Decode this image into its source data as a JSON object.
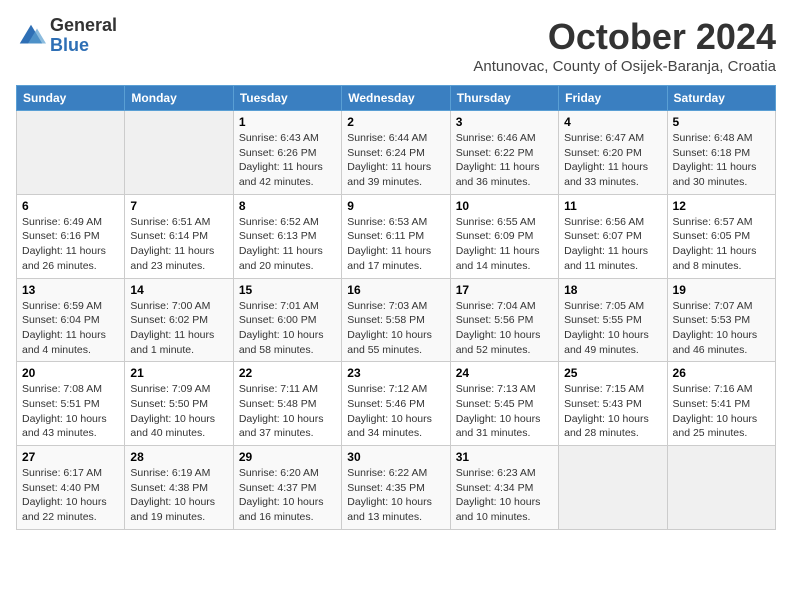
{
  "header": {
    "logo_general": "General",
    "logo_blue": "Blue",
    "month_title": "October 2024",
    "subtitle": "Antunovac, County of Osijek-Baranja, Croatia"
  },
  "weekdays": [
    "Sunday",
    "Monday",
    "Tuesday",
    "Wednesday",
    "Thursday",
    "Friday",
    "Saturday"
  ],
  "weeks": [
    [
      {
        "day": "",
        "empty": true
      },
      {
        "day": "",
        "empty": true
      },
      {
        "day": "1",
        "sunrise": "6:43 AM",
        "sunset": "6:26 PM",
        "daylight": "11 hours and 42 minutes."
      },
      {
        "day": "2",
        "sunrise": "6:44 AM",
        "sunset": "6:24 PM",
        "daylight": "11 hours and 39 minutes."
      },
      {
        "day": "3",
        "sunrise": "6:46 AM",
        "sunset": "6:22 PM",
        "daylight": "11 hours and 36 minutes."
      },
      {
        "day": "4",
        "sunrise": "6:47 AM",
        "sunset": "6:20 PM",
        "daylight": "11 hours and 33 minutes."
      },
      {
        "day": "5",
        "sunrise": "6:48 AM",
        "sunset": "6:18 PM",
        "daylight": "11 hours and 30 minutes."
      }
    ],
    [
      {
        "day": "6",
        "sunrise": "6:49 AM",
        "sunset": "6:16 PM",
        "daylight": "11 hours and 26 minutes."
      },
      {
        "day": "7",
        "sunrise": "6:51 AM",
        "sunset": "6:14 PM",
        "daylight": "11 hours and 23 minutes."
      },
      {
        "day": "8",
        "sunrise": "6:52 AM",
        "sunset": "6:13 PM",
        "daylight": "11 hours and 20 minutes."
      },
      {
        "day": "9",
        "sunrise": "6:53 AM",
        "sunset": "6:11 PM",
        "daylight": "11 hours and 17 minutes."
      },
      {
        "day": "10",
        "sunrise": "6:55 AM",
        "sunset": "6:09 PM",
        "daylight": "11 hours and 14 minutes."
      },
      {
        "day": "11",
        "sunrise": "6:56 AM",
        "sunset": "6:07 PM",
        "daylight": "11 hours and 11 minutes."
      },
      {
        "day": "12",
        "sunrise": "6:57 AM",
        "sunset": "6:05 PM",
        "daylight": "11 hours and 8 minutes."
      }
    ],
    [
      {
        "day": "13",
        "sunrise": "6:59 AM",
        "sunset": "6:04 PM",
        "daylight": "11 hours and 4 minutes."
      },
      {
        "day": "14",
        "sunrise": "7:00 AM",
        "sunset": "6:02 PM",
        "daylight": "11 hours and 1 minute."
      },
      {
        "day": "15",
        "sunrise": "7:01 AM",
        "sunset": "6:00 PM",
        "daylight": "10 hours and 58 minutes."
      },
      {
        "day": "16",
        "sunrise": "7:03 AM",
        "sunset": "5:58 PM",
        "daylight": "10 hours and 55 minutes."
      },
      {
        "day": "17",
        "sunrise": "7:04 AM",
        "sunset": "5:56 PM",
        "daylight": "10 hours and 52 minutes."
      },
      {
        "day": "18",
        "sunrise": "7:05 AM",
        "sunset": "5:55 PM",
        "daylight": "10 hours and 49 minutes."
      },
      {
        "day": "19",
        "sunrise": "7:07 AM",
        "sunset": "5:53 PM",
        "daylight": "10 hours and 46 minutes."
      }
    ],
    [
      {
        "day": "20",
        "sunrise": "7:08 AM",
        "sunset": "5:51 PM",
        "daylight": "10 hours and 43 minutes."
      },
      {
        "day": "21",
        "sunrise": "7:09 AM",
        "sunset": "5:50 PM",
        "daylight": "10 hours and 40 minutes."
      },
      {
        "day": "22",
        "sunrise": "7:11 AM",
        "sunset": "5:48 PM",
        "daylight": "10 hours and 37 minutes."
      },
      {
        "day": "23",
        "sunrise": "7:12 AM",
        "sunset": "5:46 PM",
        "daylight": "10 hours and 34 minutes."
      },
      {
        "day": "24",
        "sunrise": "7:13 AM",
        "sunset": "5:45 PM",
        "daylight": "10 hours and 31 minutes."
      },
      {
        "day": "25",
        "sunrise": "7:15 AM",
        "sunset": "5:43 PM",
        "daylight": "10 hours and 28 minutes."
      },
      {
        "day": "26",
        "sunrise": "7:16 AM",
        "sunset": "5:41 PM",
        "daylight": "10 hours and 25 minutes."
      }
    ],
    [
      {
        "day": "27",
        "sunrise": "6:17 AM",
        "sunset": "4:40 PM",
        "daylight": "10 hours and 22 minutes."
      },
      {
        "day": "28",
        "sunrise": "6:19 AM",
        "sunset": "4:38 PM",
        "daylight": "10 hours and 19 minutes."
      },
      {
        "day": "29",
        "sunrise": "6:20 AM",
        "sunset": "4:37 PM",
        "daylight": "10 hours and 16 minutes."
      },
      {
        "day": "30",
        "sunrise": "6:22 AM",
        "sunset": "4:35 PM",
        "daylight": "10 hours and 13 minutes."
      },
      {
        "day": "31",
        "sunrise": "6:23 AM",
        "sunset": "4:34 PM",
        "daylight": "10 hours and 10 minutes."
      },
      {
        "day": "",
        "empty": true
      },
      {
        "day": "",
        "empty": true
      }
    ]
  ],
  "labels": {
    "sunrise": "Sunrise:",
    "sunset": "Sunset:",
    "daylight": "Daylight:"
  }
}
